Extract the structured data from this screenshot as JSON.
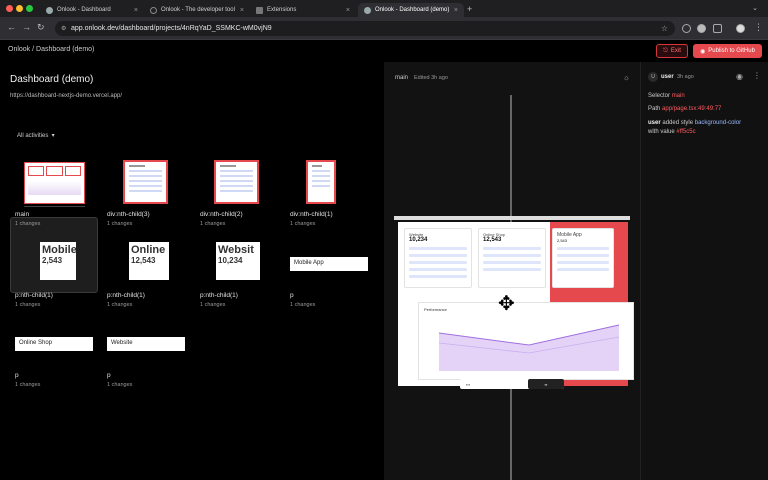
{
  "browser": {
    "tabs": [
      {
        "label": "Onlook - Dashboard",
        "active": false
      },
      {
        "label": "Onlook - The developer tool",
        "active": false
      },
      {
        "label": "Extensions",
        "active": false
      },
      {
        "label": "Onlook - Dashboard (demo)",
        "active": true
      }
    ],
    "new_tab": "+",
    "url": "app.onlook.dev/dashboard/projects/4nRqYaD_SSMKC-wM0vjN9"
  },
  "header": {
    "breadcrumb": "Onlook / Dashboard (demo)",
    "exit_label": "Exit",
    "publish_label": "Publish to GitHub"
  },
  "project": {
    "title": "Dashboard (demo)",
    "url": "https://dashboard-nextjs-demo.vercel.app/",
    "filter_label": "All activities"
  },
  "cards": [
    {
      "name": "main",
      "changes": "1 changes"
    },
    {
      "name": "div:nth-child(3)",
      "changes": "1 changes"
    },
    {
      "name": "div:nth-child(2)",
      "changes": "1 changes"
    },
    {
      "name": "div:nth-child(1)",
      "changes": "1 changes"
    },
    {
      "name": "p:nth-child(1)",
      "changes": "1 changes",
      "thumb_title": "Mobile",
      "thumb_value": "2,543"
    },
    {
      "name": "p:nth-child(1)",
      "changes": "1 changes",
      "thumb_title": "Online",
      "thumb_value": "12,543"
    },
    {
      "name": "p:nth-child(1)",
      "changes": "1 changes",
      "thumb_title": "Websit",
      "thumb_value": "10,234"
    },
    {
      "name": "p",
      "changes": "1 changes",
      "thumb_title": "Mobile App"
    },
    {
      "name": "p",
      "changes": "1 changes",
      "thumb_title": "Online Shop"
    },
    {
      "name": "p",
      "changes": "1 changes",
      "thumb_title": "Website"
    }
  ],
  "canvas": {
    "branch": "main",
    "edited": "Edited 3h ago",
    "preview_cards": [
      {
        "title": "Website",
        "value": "10,234"
      },
      {
        "title": "Online Shop",
        "value": "12,543"
      },
      {
        "title": "Mobile App",
        "value": "2,543"
      }
    ],
    "perf_title": "Performance"
  },
  "activity": {
    "user": "user",
    "time": "3h ago",
    "selector_label": "Selector",
    "selector_value": "main",
    "path_label": "Path",
    "path_value": "app/page.tsx:49:49:77",
    "action_user": "user",
    "action_text": "added style",
    "action_prop": "background-color",
    "with_value_label": "with value",
    "value": "#ff5c5c"
  },
  "colors": {
    "accent": "#e5484d",
    "link": "#9ab7ff",
    "bg": "#000000"
  }
}
